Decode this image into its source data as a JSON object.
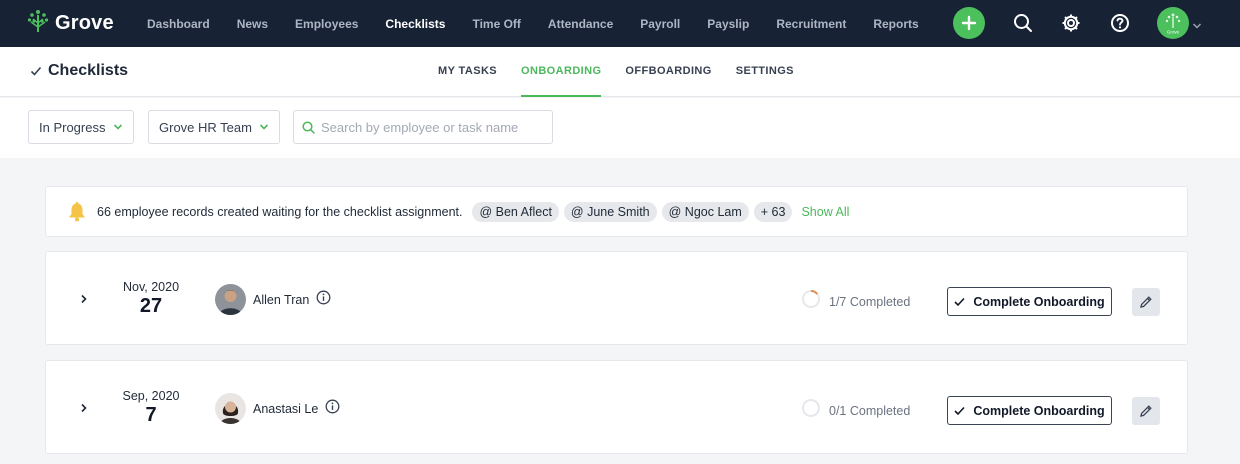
{
  "brand": {
    "name": "Grove"
  },
  "nav": {
    "items": [
      "Dashboard",
      "News",
      "Employees",
      "Checklists",
      "Time Off",
      "Attendance",
      "Payroll",
      "Payslip",
      "Recruitment",
      "Reports"
    ],
    "active": "Checklists",
    "avatar_label": "Grove"
  },
  "page": {
    "title": "Checklists",
    "tabs": [
      "MY TASKS",
      "ONBOARDING",
      "OFFBOARDING",
      "SETTINGS"
    ],
    "active_tab": "ONBOARDING"
  },
  "filters": {
    "status": "In Progress",
    "team": "Grove HR Team",
    "search_placeholder": "Search by employee or task name"
  },
  "notice": {
    "text": "66 employee records created waiting for the checklist assignment.",
    "mentions": [
      "@ Ben Aflect",
      "@ June Smith",
      "@ Ngoc Lam"
    ],
    "more": "+ 63",
    "show_all": "Show All"
  },
  "rows": [
    {
      "month": "Nov, 2020",
      "day": "27",
      "name": "Allen Tran",
      "progress_text": "1/7 Completed",
      "progress": 0.1429,
      "action": "Complete Onboarding"
    },
    {
      "month": "Sep, 2020",
      "day": "7",
      "name": "Anastasi Le",
      "progress_text": "0/1 Completed",
      "progress": 0,
      "action": "Complete Onboarding"
    }
  ],
  "colors": {
    "nav_bg": "#172235",
    "accent": "#4cb85c",
    "progress_arc": "#e58a4f"
  }
}
